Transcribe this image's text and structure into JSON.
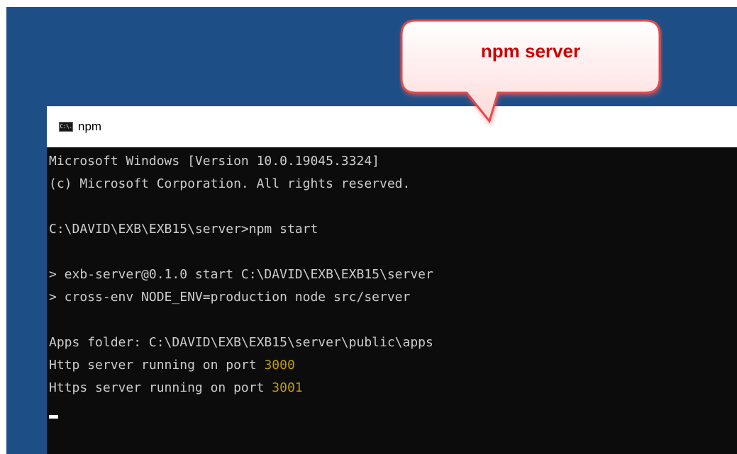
{
  "window": {
    "title": "npm",
    "icon": "cmd-icon",
    "icon_glyph": "C:\\."
  },
  "callout": {
    "text": "npm server",
    "fill_color": "#ffecec",
    "border_color": "#e44a4a",
    "text_color": "#cc0000"
  },
  "console": {
    "text_color": "#cccccc",
    "highlight_color": "#c19c00",
    "lines": {
      "l1": "Microsoft Windows [Version 10.0.19045.3324]",
      "l2": "(c) Microsoft Corporation. All rights reserved.",
      "l3": "C:\\DAVID\\EXB\\EXB15\\server>npm start",
      "l4": "> exb-server@0.1.0 start C:\\DAVID\\EXB\\EXB15\\server",
      "l5": "> cross-env NODE_ENV=production node src/server",
      "l6": "Apps folder: C:\\DAVID\\EXB\\EXB15\\server\\public\\apps",
      "l7_prefix": "Http server running on port ",
      "l7_port": "3000",
      "l8_prefix": "Https server running on port ",
      "l8_port": "3001"
    }
  }
}
